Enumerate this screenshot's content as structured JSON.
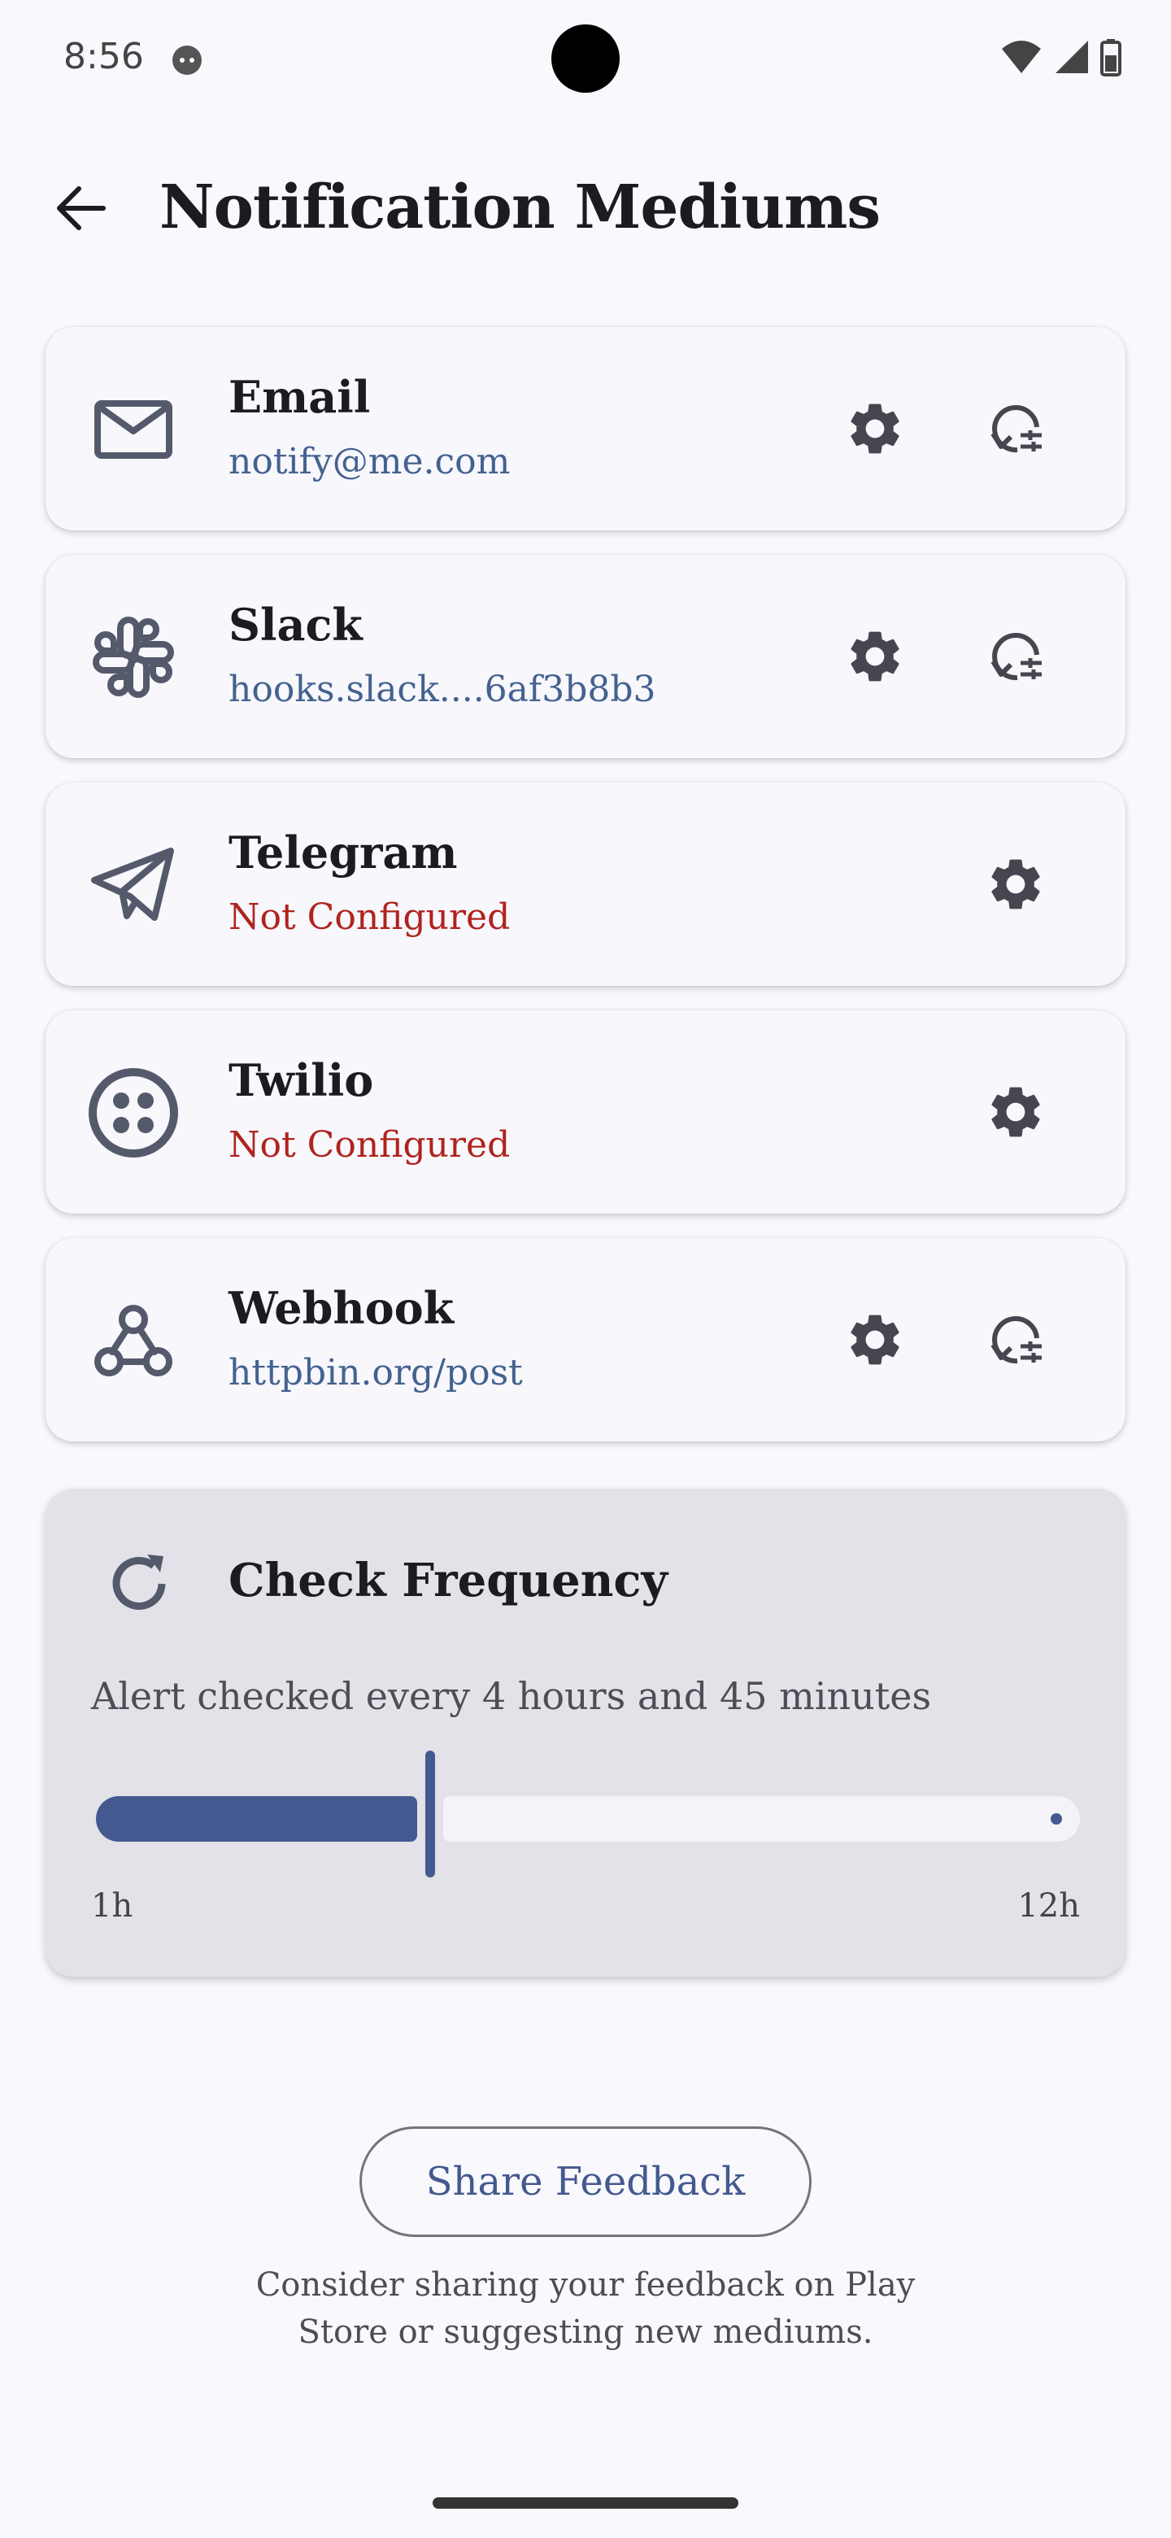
{
  "status_bar": {
    "time": "8:56"
  },
  "header": {
    "title": "Notification Mediums"
  },
  "mediums": [
    {
      "name": "Email",
      "detail": "notify@me.com",
      "configured": true,
      "icon": "mail-icon"
    },
    {
      "name": "Slack",
      "detail": "hooks.slack....6af3b8b3",
      "configured": true,
      "icon": "slack-icon"
    },
    {
      "name": "Telegram",
      "detail": "Not Configured",
      "configured": false,
      "icon": "telegram-icon"
    },
    {
      "name": "Twilio",
      "detail": "Not Configured",
      "configured": false,
      "icon": "twilio-icon"
    },
    {
      "name": "Webhook",
      "detail": "httpbin.org/post",
      "configured": true,
      "icon": "webhook-icon"
    }
  ],
  "frequency": {
    "title": "Check Frequency",
    "description": "Alert checked every 4 hours and 45 minutes",
    "min_label": "1h",
    "max_label": "12h",
    "value_fraction": 0.34
  },
  "feedback": {
    "button_label": "Share Feedback",
    "note": "Consider sharing your feedback on Play Store or suggesting new mediums."
  },
  "colors": {
    "accent": "#44598f",
    "error": "#b0231d",
    "background": "#f8f8fd"
  }
}
